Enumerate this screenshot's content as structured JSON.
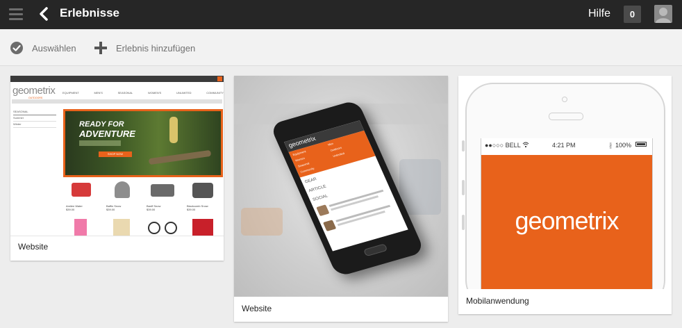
{
  "header": {
    "title": "Erlebnisse",
    "help_label": "Hilfe",
    "notification_count": "0"
  },
  "toolbar": {
    "select_label": "Auswählen",
    "add_label": "Erlebnis hinzufügen"
  },
  "cards": [
    {
      "label": "Website",
      "thumbnail": {
        "brand": "geometrix",
        "brand_sub": "OUTDOORS",
        "nav": [
          "EQUIPMENT",
          "MEN'S",
          "SEASONAL",
          "WOMEN'S",
          "UNLIMITED",
          "COMMUNITY"
        ],
        "sidebar": [
          "SEASONAL",
          "Summer",
          "Winter"
        ],
        "hero_line1": "READY FOR",
        "hero_line2": "ADVENTURE",
        "hero_button": "SHOP NOW",
        "products": [
          {
            "name": "Amilen Water",
            "price": "$39.00"
          },
          {
            "name": "Baffin Snow",
            "price": "$39.00"
          },
          {
            "name": "Banff Snow",
            "price": "$39.00"
          },
          {
            "name": "Blackcomb Snow",
            "price": "$39.00"
          }
        ]
      }
    },
    {
      "label": "Website",
      "thumbnail": {
        "brand": "geometrix",
        "menu": [
          "Equipment",
          "Men",
          "Women",
          "Outdoors",
          "Seasonal",
          "Unlimited",
          "Community"
        ],
        "sections": [
          "GEAR",
          "ARTICLE",
          "SOCIAL"
        ]
      }
    },
    {
      "label": "Mobilanwendung",
      "thumbnail": {
        "carrier": "●●○○○ BELL",
        "time": "4:21 PM",
        "battery": "100%",
        "app_name": "geometrix"
      }
    }
  ],
  "colors": {
    "topbar": "#262626",
    "accent_orange": "#e8621b",
    "background": "#ededed"
  }
}
